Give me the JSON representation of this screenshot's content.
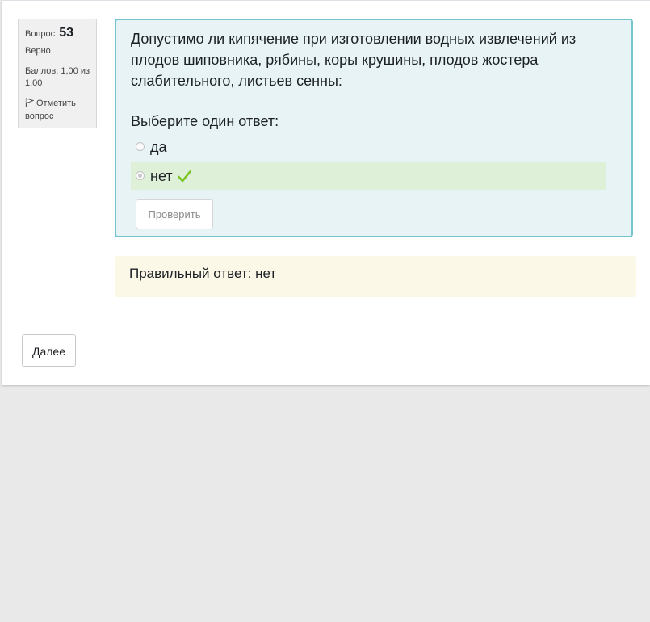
{
  "question_info": {
    "number_label": "Вопрос",
    "number": "53",
    "state": "Верно",
    "grade": "Баллов: 1,00 из 1,00",
    "flag_label": "Отметить вопрос"
  },
  "question": {
    "text": "Допустимо ли кипячение при изготовлении водных извлечений из плодов шиповника, рябины, коры крушины, плодов жостера слабительного, листьев сенны:",
    "prompt": "Выберите один ответ:",
    "options": [
      {
        "label": "да",
        "selected": false
      },
      {
        "label": "нет",
        "selected": true,
        "correct": true
      }
    ],
    "check_button": "Проверить"
  },
  "feedback": {
    "right_answer": "Правильный ответ: нет"
  },
  "navigation": {
    "next_button": "Далее"
  },
  "colors": {
    "formulation_bg": "#e7f3f5",
    "formulation_border": "#73c5cf",
    "correct_bg": "#dff0d8",
    "feedback_bg": "#fcf8e8",
    "check_mark": "#7cc529"
  },
  "icons": {
    "flag": "flag-icon",
    "correct": "check-mark-icon"
  }
}
